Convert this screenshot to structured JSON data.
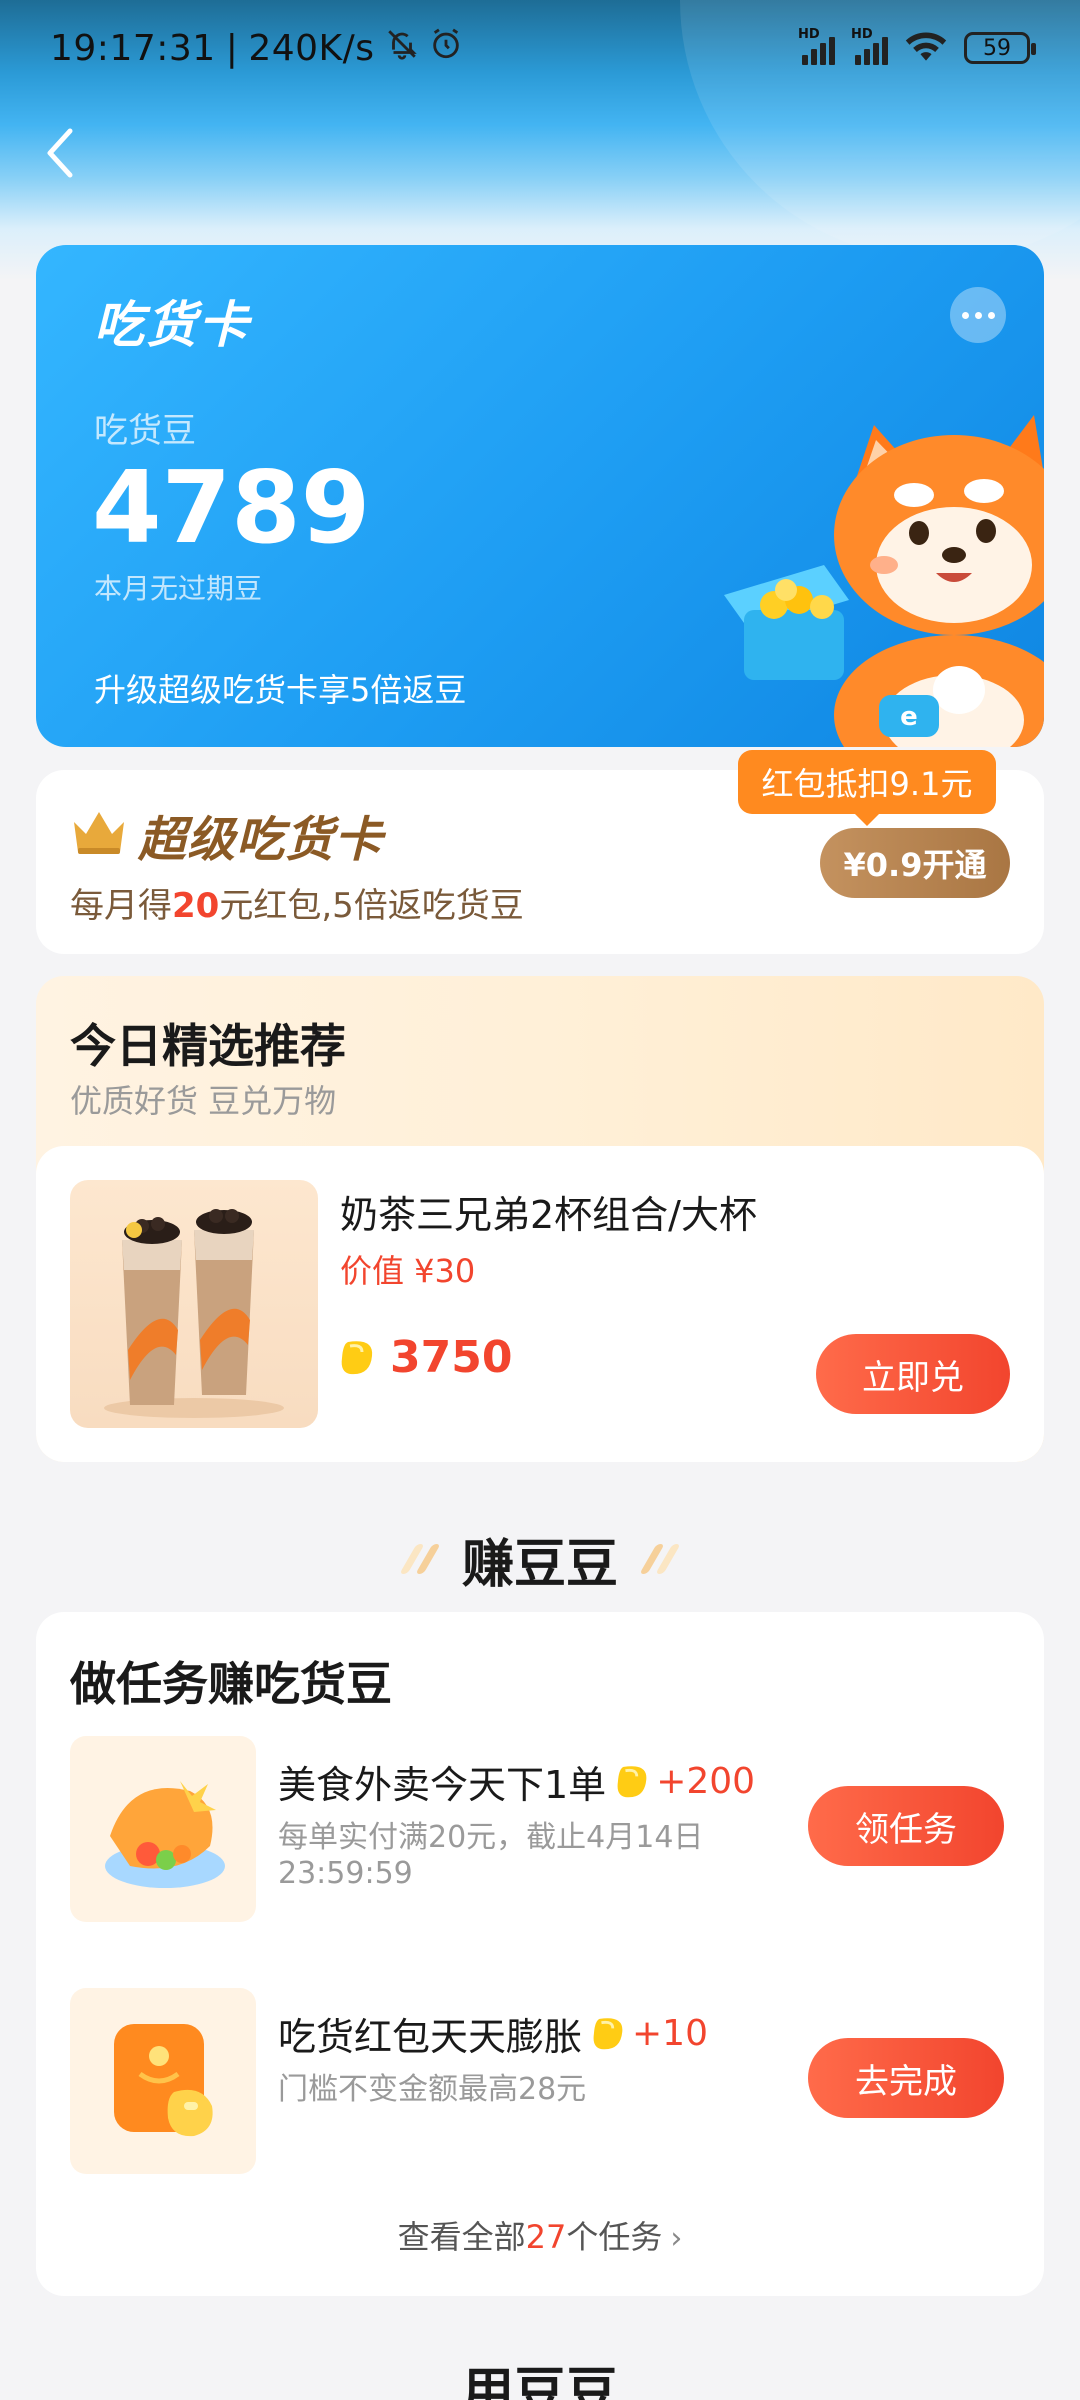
{
  "status_bar": {
    "time": "19:17:31",
    "speed": "240K/s",
    "mute_icon": "bell-slash-icon",
    "alarm_icon": "alarm-icon",
    "signal_label": "HD",
    "battery": "59"
  },
  "nav": {
    "back_icon": "chevron-left-icon"
  },
  "card": {
    "title": "吃货卡",
    "bean_label": "吃货豆",
    "bean_value": "4789",
    "bean_sub": "本月无过期豆",
    "upgrade_text": "升级超级吃货卡享5倍返豆",
    "more_icon": "more-icon"
  },
  "super_card": {
    "title": "超级吃货卡",
    "desc_prefix": "每月得",
    "desc_highlight": "20",
    "desc_suffix": "元红包,5倍返吃货豆",
    "discount_tag": "红包抵扣9.1元",
    "open_button": "¥0.9开通"
  },
  "recommend": {
    "title": "今日精选推荐",
    "subtitle": "优质好货 豆兑万物",
    "product": {
      "name": "奶茶三兄弟2杯组合/大杯",
      "value": "价值 ¥30",
      "price": "3750",
      "button": "立即兑"
    }
  },
  "earn": {
    "heading": "赚豆豆",
    "section_title": "做任务赚吃货豆",
    "tasks": [
      {
        "name": "美食外卖今天下1单",
        "reward": "+200",
        "desc": "每单实付满20元，截止4月14日23:59:59",
        "button": "领任务"
      },
      {
        "name": "吃货红包天天膨胀",
        "reward": "+10",
        "desc": "门槛不变金额最高28元",
        "button": "去完成"
      }
    ],
    "view_all_prefix": "查看全部",
    "view_all_count": "27",
    "view_all_suffix": "个任务"
  },
  "use_heading": "用豆豆",
  "colors": {
    "brand_blue": "#1d9cf2",
    "accent_red": "#f2452e",
    "gold": "#a97643",
    "orange": "#ff8a1f"
  }
}
